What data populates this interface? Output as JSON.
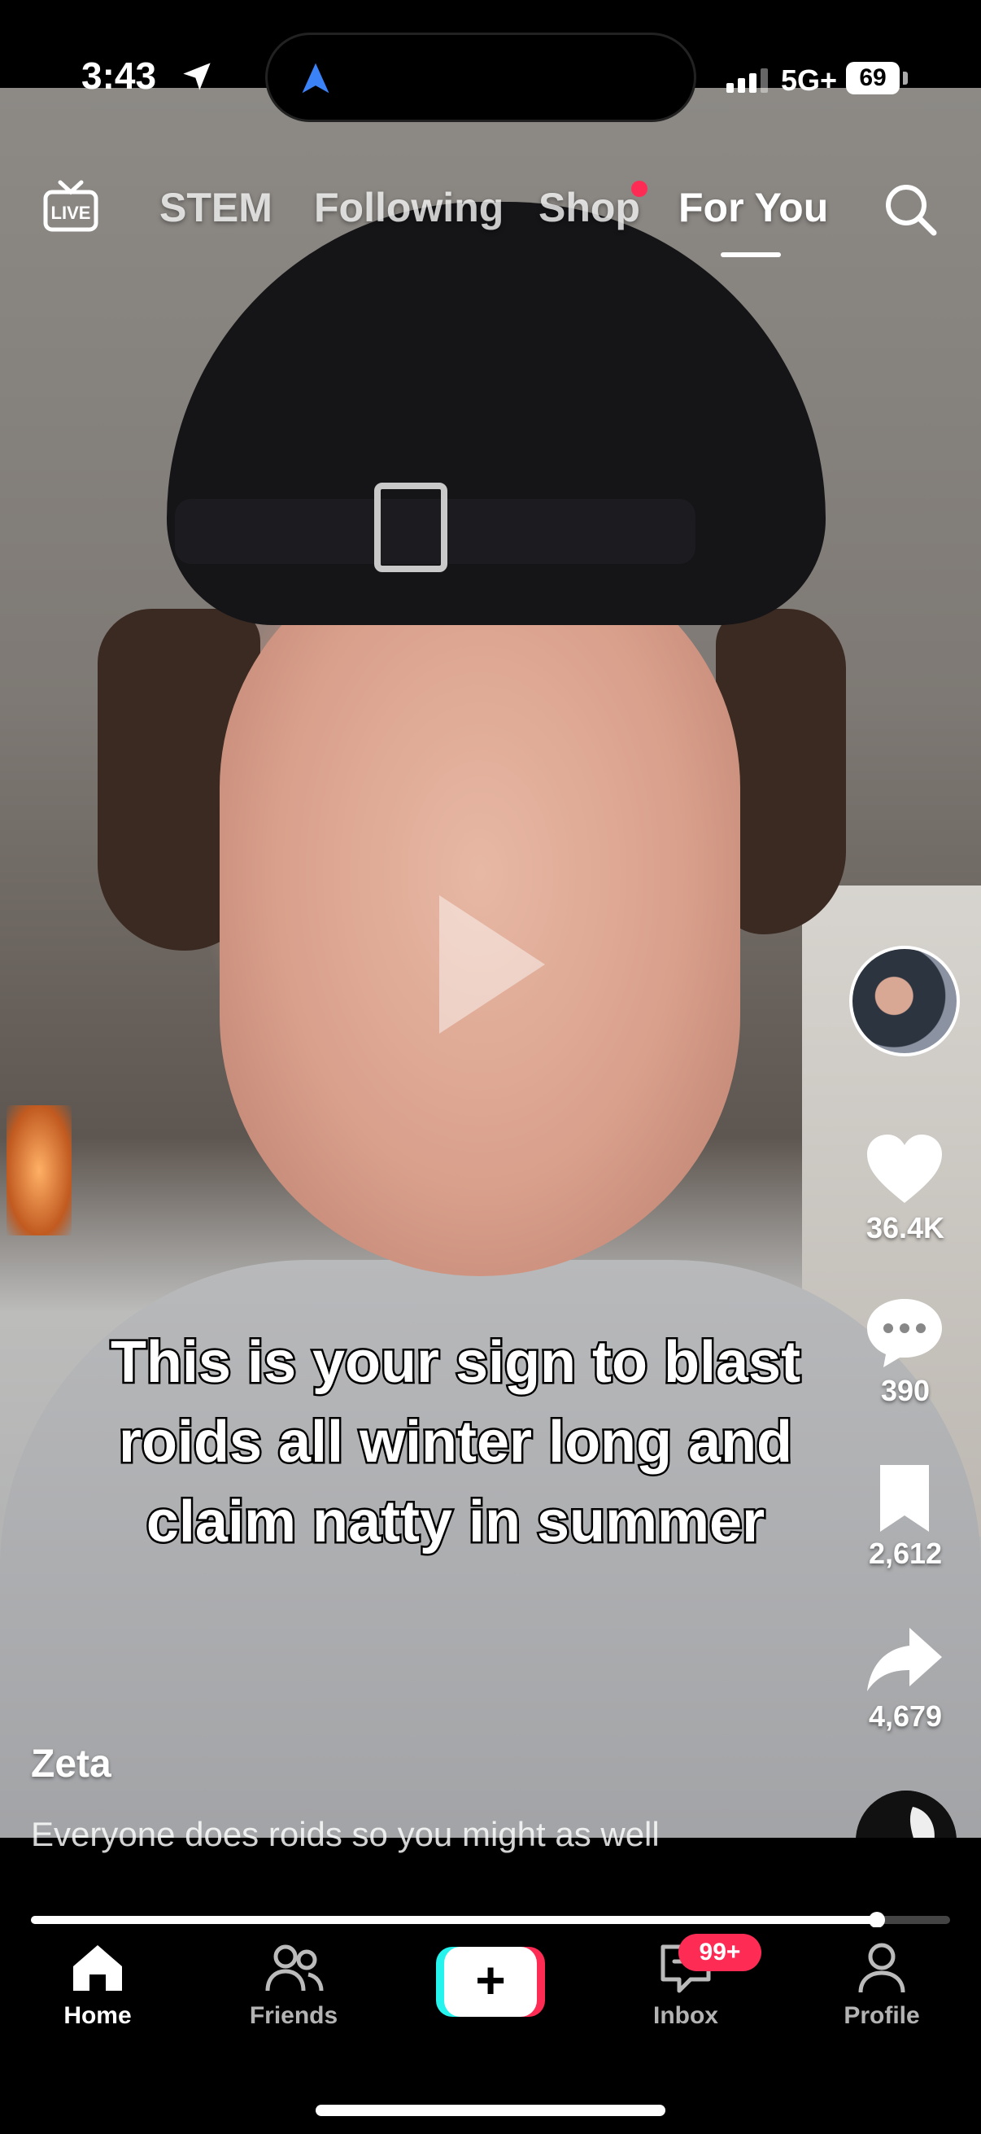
{
  "status_bar": {
    "time": "3:43",
    "network": "5G+",
    "battery": "69"
  },
  "top_tabs": {
    "live_icon": "live-icon",
    "tabs": [
      {
        "label": "STEM"
      },
      {
        "label": "Following"
      },
      {
        "label": "Shop",
        "has_dot": true
      },
      {
        "label": "For You",
        "active": true
      }
    ],
    "search_icon": "search-icon"
  },
  "video": {
    "caption": "This is your sign to blast roids all winter long and claim natty in summer",
    "author": "Zeta",
    "description": "Everyone does roids so you might as well",
    "progress": 0.92
  },
  "actions": {
    "likes": "36.4K",
    "comments": "390",
    "bookmarks": "2,612",
    "shares": "4,679"
  },
  "bottom_nav": {
    "items": [
      {
        "label": "Home",
        "icon": "home-icon",
        "active": true
      },
      {
        "label": "Friends",
        "icon": "friends-icon"
      },
      {
        "label": "",
        "icon": "create-plus-icon"
      },
      {
        "label": "Inbox",
        "icon": "inbox-icon",
        "badge": "99+"
      },
      {
        "label": "Profile",
        "icon": "profile-icon"
      }
    ]
  },
  "colors": {
    "accent_red": "#fe2c55",
    "accent_cyan": "#25f4ee",
    "background": "#000000"
  }
}
